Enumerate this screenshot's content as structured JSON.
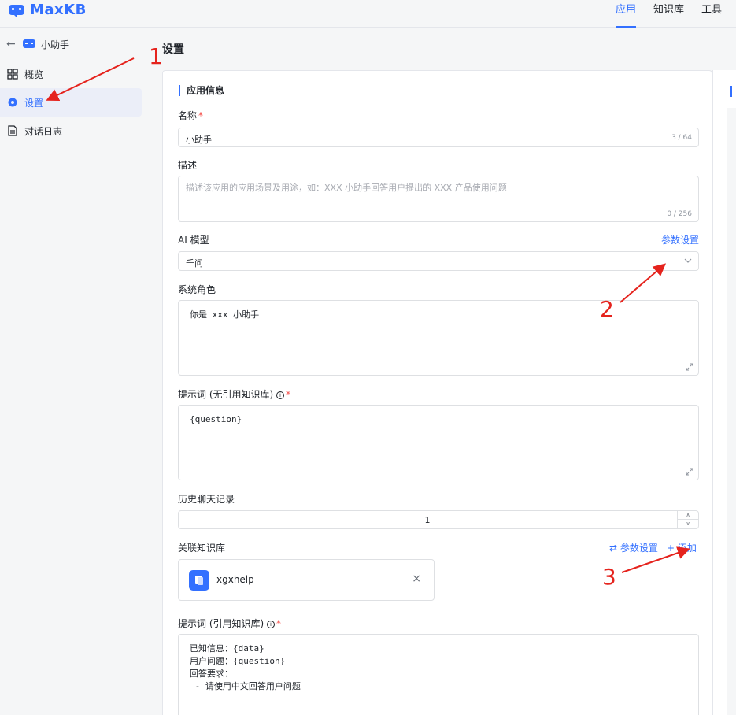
{
  "header": {
    "logo_text": "MaxKB",
    "nav": [
      {
        "label": "应用",
        "active": true
      },
      {
        "label": "知识库",
        "active": false
      },
      {
        "label": "工具",
        "active": false
      }
    ]
  },
  "sidebar": {
    "back_icon": "arrow-left-icon",
    "app_name": "小助手",
    "items": [
      {
        "label": "概览",
        "icon": "grid-icon",
        "active": false
      },
      {
        "label": "设置",
        "icon": "gear-icon",
        "active": true
      },
      {
        "label": "对话日志",
        "icon": "document-icon",
        "active": false
      }
    ]
  },
  "page": {
    "title": "设置"
  },
  "form": {
    "section_title": "应用信息",
    "name": {
      "label": "名称",
      "value": "小助手",
      "count": "3 / 64"
    },
    "description": {
      "label": "描述",
      "placeholder": "描述该应用的应用场景及用途，如：XXX 小助手回答用户提出的 XXX 产品使用问题",
      "count": "0 / 256"
    },
    "model": {
      "label": "AI 模型",
      "link": "参数设置",
      "value": "千问"
    },
    "system_role": {
      "label": "系统角色",
      "value": "你是 xxx 小助手"
    },
    "prompt_no_kb": {
      "label": "提示词 (无引用知识库)",
      "value": "{question}"
    },
    "history": {
      "label": "历史聊天记录",
      "value": "1"
    },
    "kb": {
      "label": "关联知识库",
      "settings_link": "参数设置",
      "add_link": "添加",
      "item_name": "xgxhelp"
    },
    "prompt_kb": {
      "label": "提示词 (引用知识库)",
      "value": "已知信息：{data}\n用户问题：{question}\n回答要求：\n - 请使用中文回答用户问题"
    }
  },
  "annotations": [
    "1",
    "2",
    "3"
  ],
  "colors": {
    "accent": "#3370ff",
    "annotation": "#e5231d",
    "required": "#f54a45"
  }
}
